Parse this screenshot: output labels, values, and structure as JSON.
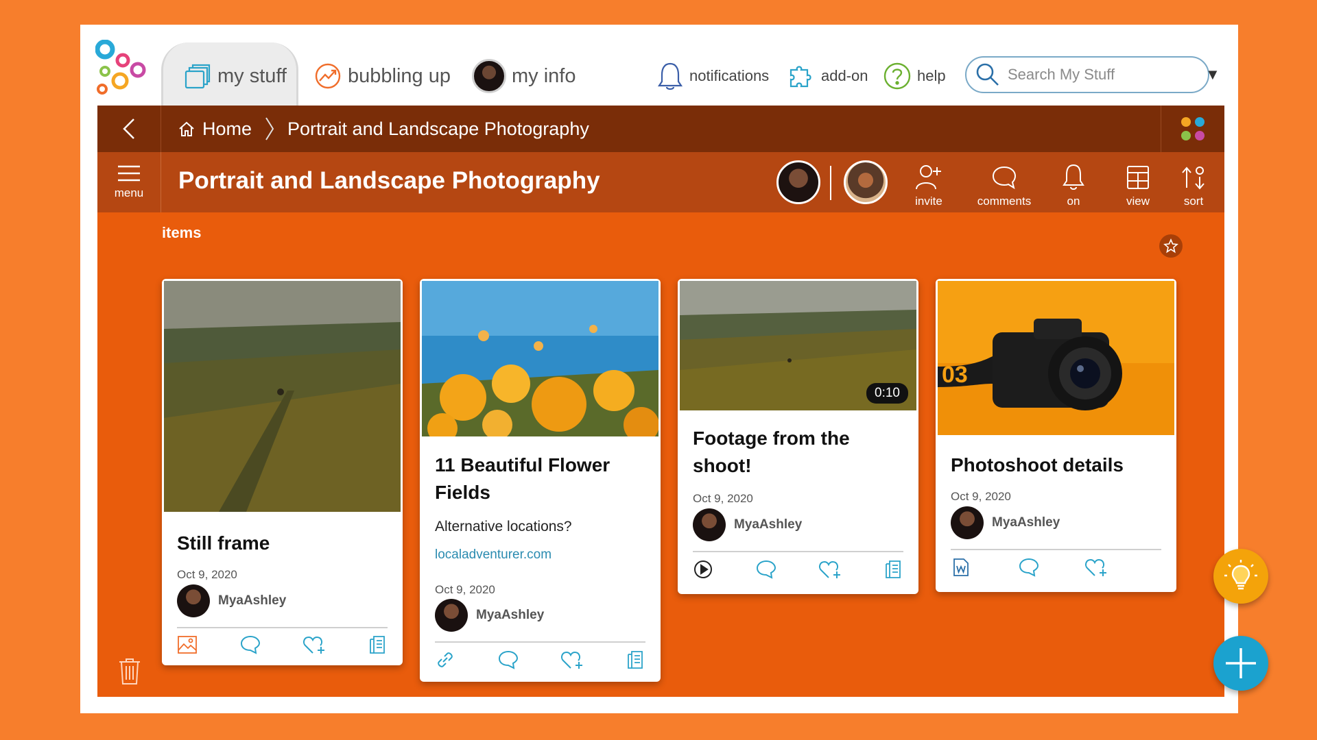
{
  "nav": {
    "tabs": [
      {
        "label": "my stuff",
        "icon": "folders-icon",
        "active": true
      },
      {
        "label": "bubbling up",
        "icon": "trending-icon"
      },
      {
        "label": "my info",
        "icon": "avatar"
      }
    ],
    "actions": [
      {
        "label": "notifications",
        "icon": "bell-icon"
      },
      {
        "label": "add-on",
        "icon": "puzzle-icon"
      },
      {
        "label": "help",
        "icon": "help-icon"
      }
    ],
    "search_placeholder": "Search My Stuff"
  },
  "breadcrumb": {
    "home": "Home",
    "current": "Portrait and Landscape Photography"
  },
  "titlebar": {
    "menu_label": "menu",
    "title": "Portrait and Landscape Photography",
    "tools": [
      "invite",
      "comments",
      "on",
      "view",
      "sort"
    ]
  },
  "content": {
    "section_label": "items",
    "cards": [
      {
        "title": "Still frame",
        "date": "Oct 9, 2020",
        "author": "MyaAshley",
        "type_icon": "image-icon"
      },
      {
        "title": "11 Beautiful Flower Fields",
        "description": "Alternative locations?",
        "link": "localadventurer.com",
        "date": "Oct 9, 2020",
        "author": "MyaAshley",
        "type_icon": "link-icon"
      },
      {
        "title": "Footage from the shoot!",
        "date": "Oct 9, 2020",
        "author": "MyaAshley",
        "duration": "0:10",
        "type_icon": "play-icon"
      },
      {
        "title": "Photoshoot details",
        "date": "Oct 9, 2020",
        "author": "MyaAshley",
        "type_icon": "word-doc-icon"
      }
    ]
  },
  "colors": {
    "page_bg": "#f77e2c",
    "crumb_bar": "#7a2d08",
    "title_bar": "#b54712",
    "content_bg": "#e95c0c",
    "accent_blue": "#1ba2cf",
    "accent_yellow": "#f4a30a"
  }
}
